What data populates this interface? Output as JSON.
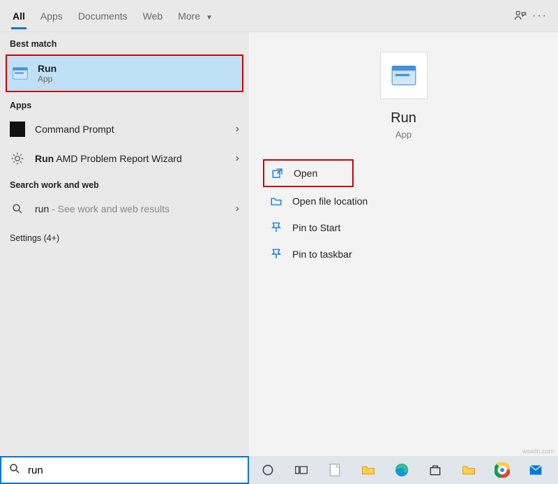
{
  "header": {
    "tabs": {
      "all": "All",
      "apps": "Apps",
      "documents": "Documents",
      "web": "Web",
      "more": "More"
    }
  },
  "left": {
    "bestMatchLabel": "Best match",
    "best": {
      "title": "Run",
      "subtitle": "App"
    },
    "appsLabel": "Apps",
    "apps": {
      "cmd": "Command Prompt",
      "amdPre": "Run",
      "amdRest": " AMD Problem Report Wizard"
    },
    "searchSectionLabel": "Search work and web",
    "searchRun": {
      "pre": "run",
      "rest": " - See work and web results"
    },
    "settings": "Settings (4+)"
  },
  "right": {
    "title": "Run",
    "subtitle": "App",
    "actions": {
      "open": "Open",
      "openLoc": "Open file location",
      "pinStart": "Pin to Start",
      "pinTaskbar": "Pin to taskbar"
    }
  },
  "search": {
    "value": "run"
  },
  "watermark": "wsxdn.com"
}
